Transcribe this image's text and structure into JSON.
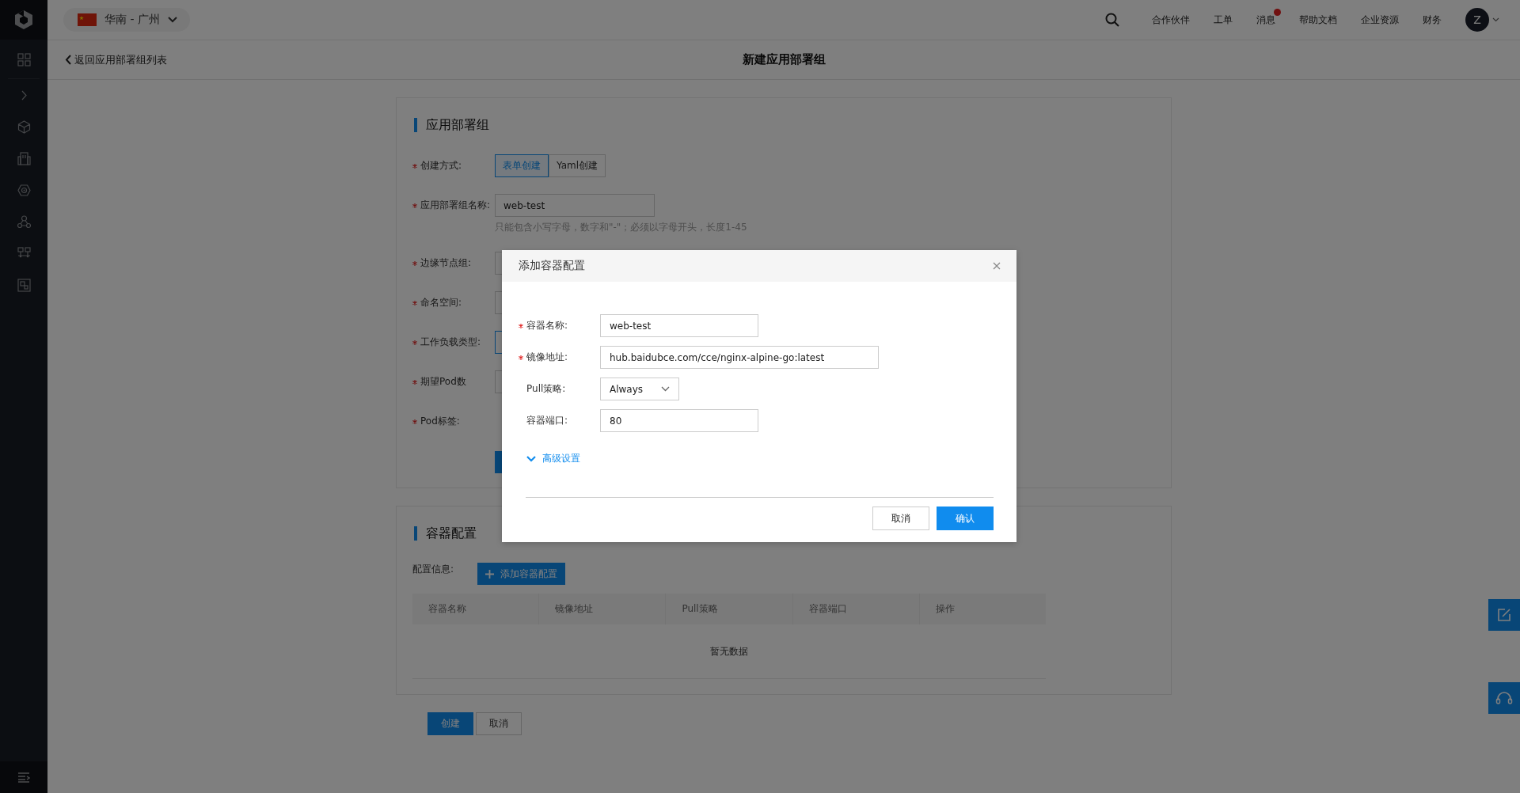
{
  "topbar": {
    "region": "华南 - 广州",
    "nav": [
      {
        "label": "合作伙伴",
        "badge": false
      },
      {
        "label": "工单",
        "badge": false
      },
      {
        "label": "消息",
        "badge": true
      },
      {
        "label": "帮助文档",
        "badge": false
      },
      {
        "label": "企业资源",
        "badge": false
      },
      {
        "label": "财务",
        "badge": false
      }
    ],
    "avatar": "Z"
  },
  "subheader": {
    "back": "返回应用部署组列表",
    "title": "新建应用部署组"
  },
  "section_1": {
    "title": "应用部署组",
    "fields": [
      {
        "label": "创建方式:",
        "required": true,
        "kind": "segmented",
        "options": [
          {
            "label": "表单创建",
            "selected": true
          },
          {
            "label": "Yaml创建",
            "selected": false
          }
        ]
      },
      {
        "label": "应用部署组名称:",
        "required": true,
        "kind": "input",
        "value": "web-test",
        "hint": "只能包含小写字母，数字和\"-\"；必须以字母开头，长度1-45"
      },
      {
        "label": "边缘节点组:",
        "required": true,
        "kind": "input",
        "focused": false
      },
      {
        "label": "命名空间:",
        "required": true,
        "kind": "input",
        "focused": false
      },
      {
        "label": "工作负载类型:",
        "required": true,
        "kind": "input",
        "focused": true
      },
      {
        "label": "期望Pod数",
        "required": true,
        "kind": "input",
        "focused": false
      },
      {
        "label": "Pod标签:",
        "required": true,
        "kind": "none"
      },
      {
        "kind": "primary-button"
      }
    ]
  },
  "section_2": {
    "title": "容器配置",
    "label": "配置信息:",
    "add_button": "添加容器配置",
    "table": {
      "columns": [
        "容器名称",
        "镜像地址",
        "Pull策略",
        "容器端口",
        "操作"
      ],
      "empty": "暂无数据"
    }
  },
  "footer_buttons": [
    {
      "label": "创建",
      "kind": "primary"
    },
    {
      "label": "取消",
      "kind": "default"
    }
  ],
  "modal": {
    "title": "添加容器配置",
    "fields": [
      {
        "label": "容器名称:",
        "required": true,
        "kind": "input",
        "value": "web-test"
      },
      {
        "label": "镜像地址:",
        "required": true,
        "kind": "wide-input",
        "value": "hub.baidubce.com/cce/nginx-alpine-go:latest"
      },
      {
        "label": "Pull策略:",
        "required": false,
        "kind": "select",
        "value": "Always"
      },
      {
        "label": "容器端口:",
        "required": false,
        "kind": "input",
        "value": "80"
      }
    ],
    "advanced": {
      "label": "高级设置",
      "expanded": false
    },
    "buttons": [
      {
        "label": "取消",
        "kind": "default"
      },
      {
        "label": "确认",
        "kind": "primary"
      }
    ]
  }
}
